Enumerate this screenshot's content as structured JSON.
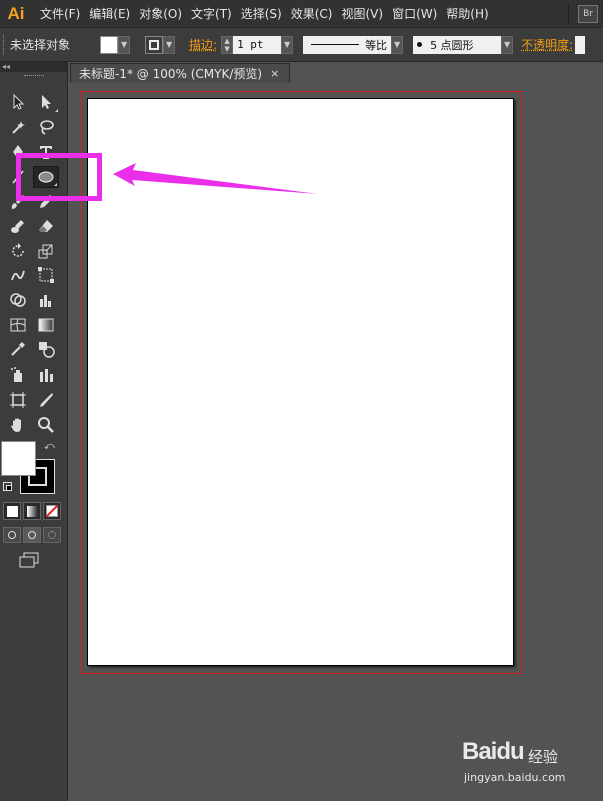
{
  "app": {
    "logo": "Ai",
    "bridge_button": "Br"
  },
  "menu": [
    "文件(F)",
    "编辑(E)",
    "对象(O)",
    "文字(T)",
    "选择(S)",
    "效果(C)",
    "视图(V)",
    "窗口(W)",
    "帮助(H)"
  ],
  "controlbar": {
    "selection_label": "未选择对象",
    "stroke_label": "描边:",
    "stroke_weight": "1 pt",
    "stroke_style": "等比",
    "brush_label": "5 点圆形",
    "opacity_label": "不透明度:"
  },
  "toolpanel": {
    "collapse_glyph": "◂◂"
  },
  "document": {
    "tab_title": "未标题-1* @ 100% (CMYK/预览)",
    "close_glyph": "×"
  },
  "annotation": {
    "color": "#ea2eea",
    "target": "ellipse-tool"
  },
  "watermark": {
    "brand": "Baidu",
    "cn": "经验",
    "url": "jingyan.baidu.com"
  },
  "colors": {
    "bleed": "#d21f1f",
    "accent": "#f7a21b"
  }
}
